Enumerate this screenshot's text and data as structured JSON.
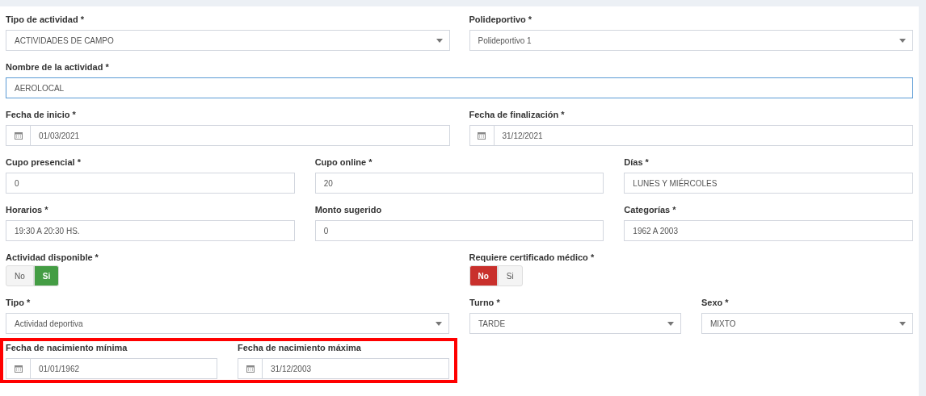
{
  "rows": [
    {
      "highlighted": false,
      "fields": [
        {
          "kind": "select",
          "label": "Tipo de actividad *",
          "value": "ACTIVIDADES DE CAMPO"
        },
        {
          "kind": "select",
          "label": "Polideportivo *",
          "value": "Polideportivo 1"
        }
      ]
    },
    {
      "highlighted": false,
      "fields": [
        {
          "kind": "text",
          "label": "Nombre de la actividad *",
          "value": "AEROLOCAL",
          "focused": true
        }
      ]
    },
    {
      "highlighted": false,
      "fields": [
        {
          "kind": "date",
          "label": "Fecha de inicio *",
          "value": "01/03/2021"
        },
        {
          "kind": "date",
          "label": "Fecha de finalización *",
          "value": "31/12/2021"
        }
      ]
    },
    {
      "highlighted": false,
      "fields": [
        {
          "kind": "text",
          "label": "Cupo presencial *",
          "value": "0",
          "focused": false
        },
        {
          "kind": "text",
          "label": "Cupo online *",
          "value": "20",
          "focused": false
        },
        {
          "kind": "text",
          "label": "Días *",
          "value": "LUNES Y MIÉRCOLES",
          "focused": false
        }
      ]
    },
    {
      "highlighted": false,
      "fields": [
        {
          "kind": "text",
          "label": "Horarios *",
          "value": "19:30 A 20:30 HS.",
          "focused": false
        },
        {
          "kind": "text",
          "label": "Monto sugerido",
          "value": "0",
          "focused": false
        },
        {
          "kind": "text",
          "label": "Categorías *",
          "value": "1962 A 2003",
          "focused": false
        }
      ]
    },
    {
      "highlighted": false,
      "fields": [
        {
          "kind": "toggle",
          "label": "Actividad disponible *",
          "options": [
            {
              "label": "No",
              "selected": false
            },
            {
              "label": "Si",
              "selected": true
            }
          ]
        },
        {
          "kind": "toggle",
          "label": "Requiere certificado médico *",
          "options": [
            {
              "label": "No",
              "selected": true
            },
            {
              "label": "Si",
              "selected": false
            }
          ]
        }
      ]
    },
    {
      "highlighted": false,
      "fields": [
        {
          "kind": "select",
          "label": "Tipo *",
          "value": "Actividad deportiva"
        },
        {
          "kind": "select",
          "label": "Turno *",
          "value": "TARDE"
        },
        {
          "kind": "select",
          "label": "Sexo *",
          "value": "MIXTO"
        }
      ]
    },
    {
      "highlighted": true,
      "fields": [
        {
          "kind": "date",
          "label": "Fecha de nacimiento mínima",
          "value": "01/01/1962"
        },
        {
          "kind": "date",
          "label": "Fecha de nacimiento máxima",
          "value": "31/12/2003"
        }
      ]
    }
  ]
}
